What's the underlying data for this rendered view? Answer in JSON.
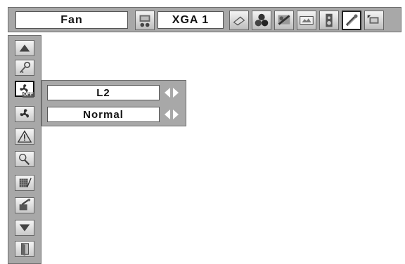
{
  "topbar": {
    "menu_title": "Fan",
    "input_signal": "XGA 1",
    "icons": [
      "computer-input-icon",
      "laptop-icon",
      "color-balls-icon",
      "picture-adjust-icon",
      "screen-icon",
      "sound-icon",
      "setting-icon",
      "expand-icon"
    ],
    "selected_icon": "setting-icon"
  },
  "sidebar": {
    "icons": [
      "up-arrow-icon",
      "key-icon",
      "fan-off-icon",
      "fan-icon",
      "warning-icon",
      "lamp-icon",
      "filter-icon",
      "reset-icon",
      "down-arrow-icon",
      "exit-icon"
    ],
    "selected_icon": "fan-off-icon",
    "fan_off_tag": "OFF"
  },
  "submenu": {
    "items": [
      {
        "value": "L2"
      },
      {
        "value": "Normal"
      }
    ]
  },
  "colors": {
    "panel": "#a8a8a8",
    "border": "#6e6e6e",
    "arrow": "#ffffff"
  }
}
